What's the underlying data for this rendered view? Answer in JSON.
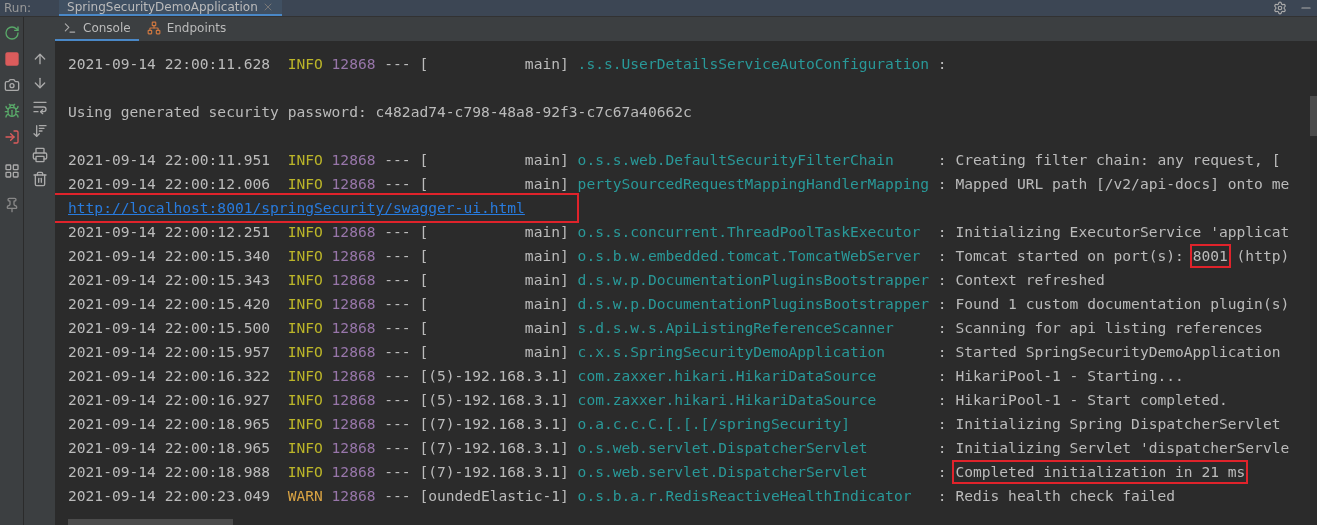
{
  "run_bar": {
    "label": "Run:",
    "tab": {
      "title": "SpringSecurityDemoApplication",
      "selected": true
    }
  },
  "tabs": [
    {
      "label": "Console",
      "selected": true
    },
    {
      "label": "Endpoints",
      "selected": false
    }
  ],
  "rows": [
    {
      "kind": "log",
      "timestamp": "2021-09-14 22:00:11.628",
      "level": "INFO",
      "warning": false,
      "pid": "12868",
      "sep": "---",
      "thread": "[           main]",
      "logger": ".s.s.UserDetailsServiceAutoConfiguration",
      "message": [
        {
          "text": ":",
          "highlighted": false
        }
      ]
    },
    {
      "kind": "blank"
    },
    {
      "kind": "text",
      "text": "Using generated security password: c482ad74-c798-48a8-92f3-c7c67a40662c"
    },
    {
      "kind": "blank"
    },
    {
      "kind": "log",
      "timestamp": "2021-09-14 22:00:11.951",
      "level": "INFO",
      "warning": false,
      "pid": "12868",
      "sep": "---",
      "thread": "[           main]",
      "logger": "o.s.s.web.DefaultSecurityFilterChain",
      "message": [
        {
          "text": ": Creating filter chain: any request, [",
          "highlighted": false
        }
      ]
    },
    {
      "kind": "log",
      "timestamp": "2021-09-14 22:00:12.006",
      "level": "INFO",
      "warning": false,
      "pid": "12868",
      "sep": "---",
      "thread": "[           main]",
      "logger": "pertySourcedRequestMappingHandlerMapping",
      "message": [
        {
          "text": ": Mapped URL path [/v2/api-docs] onto me",
          "highlighted": false
        }
      ]
    },
    {
      "kind": "link",
      "text": "http://localhost:8001/springSecurity/swagger-ui.html",
      "highlighted": true
    },
    {
      "kind": "log",
      "timestamp": "2021-09-14 22:00:12.251",
      "level": "INFO",
      "warning": false,
      "pid": "12868",
      "sep": "---",
      "thread": "[           main]",
      "logger": "o.s.s.concurrent.ThreadPoolTaskExecutor",
      "message": [
        {
          "text": ": Initializing ExecutorService 'applicat",
          "highlighted": false
        }
      ]
    },
    {
      "kind": "log",
      "timestamp": "2021-09-14 22:00:15.340",
      "level": "INFO",
      "warning": false,
      "pid": "12868",
      "sep": "---",
      "thread": "[           main]",
      "logger": "o.s.b.w.embedded.tomcat.TomcatWebServer",
      "message": [
        {
          "text": ": Tomcat started on port(s): ",
          "highlighted": false
        },
        {
          "text": "8001",
          "highlighted": true
        },
        {
          "text": " (http)",
          "highlighted": false
        }
      ]
    },
    {
      "kind": "log",
      "timestamp": "2021-09-14 22:00:15.343",
      "level": "INFO",
      "warning": false,
      "pid": "12868",
      "sep": "---",
      "thread": "[           main]",
      "logger": "d.s.w.p.DocumentationPluginsBootstrapper",
      "message": [
        {
          "text": ": Context refreshed",
          "highlighted": false
        }
      ]
    },
    {
      "kind": "log",
      "timestamp": "2021-09-14 22:00:15.420",
      "level": "INFO",
      "warning": false,
      "pid": "12868",
      "sep": "---",
      "thread": "[           main]",
      "logger": "d.s.w.p.DocumentationPluginsBootstrapper",
      "message": [
        {
          "text": ": Found 1 custom documentation plugin(s)",
          "highlighted": false
        }
      ]
    },
    {
      "kind": "log",
      "timestamp": "2021-09-14 22:00:15.500",
      "level": "INFO",
      "warning": false,
      "pid": "12868",
      "sep": "---",
      "thread": "[           main]",
      "logger": "s.d.s.w.s.ApiListingReferenceScanner",
      "message": [
        {
          "text": ": Scanning for api listing references",
          "highlighted": false
        }
      ]
    },
    {
      "kind": "log",
      "timestamp": "2021-09-14 22:00:15.957",
      "level": "INFO",
      "warning": false,
      "pid": "12868",
      "sep": "---",
      "thread": "[           main]",
      "logger": "c.x.s.SpringSecurityDemoApplication",
      "message": [
        {
          "text": ": Started SpringSecurityDemoApplication",
          "highlighted": false
        }
      ]
    },
    {
      "kind": "log",
      "timestamp": "2021-09-14 22:00:16.322",
      "level": "INFO",
      "warning": false,
      "pid": "12868",
      "sep": "---",
      "thread": "[(5)-192.168.3.1]",
      "logger": "com.zaxxer.hikari.HikariDataSource",
      "message": [
        {
          "text": ": HikariPool-1 - Starting...",
          "highlighted": false
        }
      ]
    },
    {
      "kind": "log",
      "timestamp": "2021-09-14 22:00:16.927",
      "level": "INFO",
      "warning": false,
      "pid": "12868",
      "sep": "---",
      "thread": "[(5)-192.168.3.1]",
      "logger": "com.zaxxer.hikari.HikariDataSource",
      "message": [
        {
          "text": ": HikariPool-1 - Start completed.",
          "highlighted": false
        }
      ]
    },
    {
      "kind": "log",
      "timestamp": "2021-09-14 22:00:18.965",
      "level": "INFO",
      "warning": false,
      "pid": "12868",
      "sep": "---",
      "thread": "[(7)-192.168.3.1]",
      "logger": "o.a.c.c.C.[.[.[/springSecurity]",
      "message": [
        {
          "text": ": Initializing Spring DispatcherServlet",
          "highlighted": false
        }
      ]
    },
    {
      "kind": "log",
      "timestamp": "2021-09-14 22:00:18.965",
      "level": "INFO",
      "warning": false,
      "pid": "12868",
      "sep": "---",
      "thread": "[(7)-192.168.3.1]",
      "logger": "o.s.web.servlet.DispatcherServlet",
      "message": [
        {
          "text": ": Initializing Servlet 'dispatcherServle",
          "highlighted": false
        }
      ]
    },
    {
      "kind": "log",
      "timestamp": "2021-09-14 22:00:18.988",
      "level": "INFO",
      "warning": false,
      "pid": "12868",
      "sep": "---",
      "thread": "[(7)-192.168.3.1]",
      "logger": "o.s.web.servlet.DispatcherServlet",
      "message": [
        {
          "text": ": ",
          "highlighted": false
        },
        {
          "text": "Completed initialization in 21 ms",
          "highlighted": true
        }
      ]
    },
    {
      "kind": "log",
      "timestamp": "2021-09-14 22:00:23.049",
      "level": "WARN",
      "warning": true,
      "pid": "12868",
      "sep": "---",
      "thread": "[oundedElastic-1]",
      "logger": "o.s.b.a.r.RedisReactiveHealthIndicator",
      "message": [
        {
          "text": ": Redis health check failed",
          "highlighted": false
        }
      ]
    }
  ]
}
